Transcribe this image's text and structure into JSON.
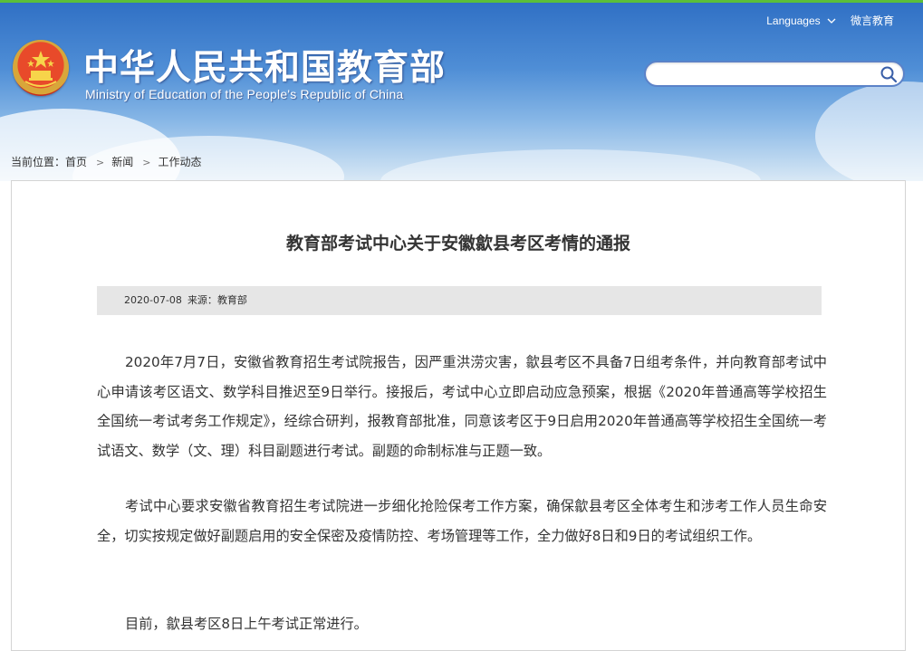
{
  "header": {
    "site_title": "中华人民共和国教育部",
    "site_subtitle": "Ministry of Education of the People's Republic of China",
    "languages_label": "Languages",
    "weibo_label": "微言教育",
    "search": {
      "value": "",
      "placeholder": ""
    }
  },
  "breadcrumb": {
    "prefix": "当前位置：",
    "items": [
      "首页",
      "新闻",
      "工作动态"
    ],
    "separator": ">"
  },
  "article": {
    "title": "教育部考试中心关于安徽歙县考区考情的通报",
    "date": "2020-07-08",
    "source_label": "来源：",
    "source": "教育部",
    "paragraphs": [
      "2020年7月7日，安徽省教育招生考试院报告，因严重洪涝灾害，歙县考区不具备7日组考条件，并向教育部考试中心申请该考区语文、数学科目推迟至9日举行。接报后，考试中心立即启动应急预案，根据《2020年普通高等学校招生全国统一考试考务工作规定》，经综合研判，报教育部批准，同意该考区于9日启用2020年普通高等学校招生全国统一考试语文、数学（文、理）科目副题进行考试。副题的命制标准与正题一致。",
      "考试中心要求安徽省教育招生考试院进一步细化抢险保考工作方案，确保歙县考区全体考生和涉考工作人员生命安全，切实按规定做好副题启用的安全保密及疫情防控、考场管理等工作，全力做好8日和9日的考试组织工作。",
      "目前，歙县考区8日上午考试正常进行。"
    ]
  },
  "icons": {
    "emblem": "national-emblem-icon",
    "search": "search-icon",
    "dropdown": "chevron-down-icon"
  },
  "colors": {
    "header_top": "#2f6fc4",
    "header_bottom": "#d8e8f5",
    "search_border": "#5b82c8",
    "text": "#333333",
    "meta_bg": "#e6e6e6"
  }
}
